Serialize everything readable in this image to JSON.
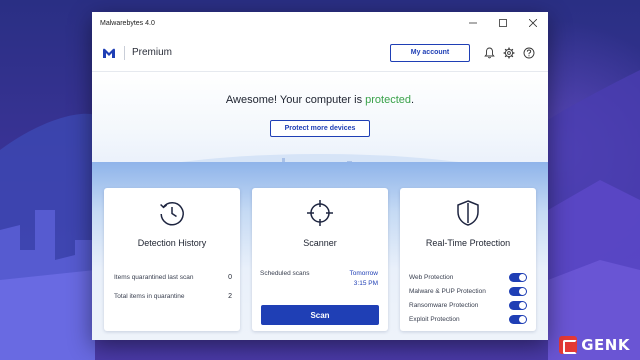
{
  "window": {
    "title": "Malwarebytes 4.0"
  },
  "header": {
    "edition": "Premium",
    "account_button": "My account",
    "icons": [
      "bell-icon",
      "gear-icon",
      "help-icon"
    ]
  },
  "hero": {
    "message_prefix": "Awesome! Your computer is",
    "message_status": "protected",
    "message_suffix": ".",
    "protect_button": "Protect more devices"
  },
  "detection_history": {
    "title": "Detection History",
    "rows": [
      {
        "label": "Items quarantined last scan",
        "value": "0"
      },
      {
        "label": "Total items in quarantine",
        "value": "2"
      }
    ]
  },
  "scanner": {
    "title": "Scanner",
    "scheduled_label": "Scheduled scans",
    "scheduled_day": "Tomorrow",
    "scheduled_time": "3:15 PM",
    "scan_button": "Scan"
  },
  "realtime": {
    "title": "Real-Time Protection",
    "items": [
      {
        "label": "Web Protection",
        "enabled": true
      },
      {
        "label": "Malware & PUP Protection",
        "enabled": true
      },
      {
        "label": "Ransomware Protection",
        "enabled": true
      },
      {
        "label": "Exploit Protection",
        "enabled": true
      }
    ]
  },
  "watermark": {
    "text": "GENK"
  },
  "colors": {
    "accent": "#1f3fb5",
    "protected": "#3aa24a",
    "brand": "#1f3fb5"
  }
}
